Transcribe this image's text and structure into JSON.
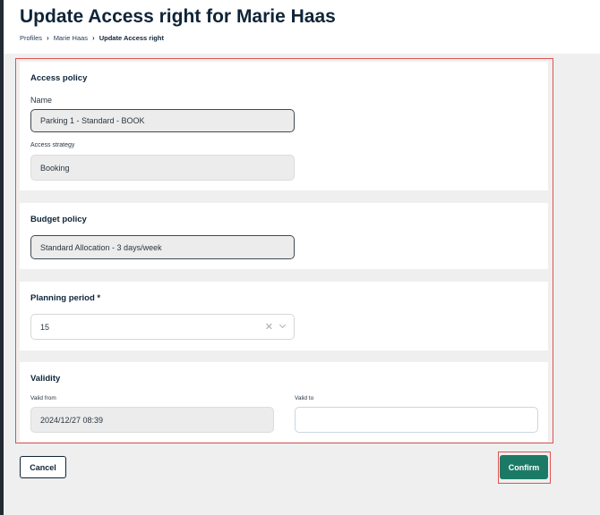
{
  "header": {
    "title": "Update Access right for Marie Haas",
    "breadcrumb": {
      "items": [
        "Profiles",
        "Marie Haas"
      ],
      "current": "Update Access right"
    }
  },
  "access_policy": {
    "title": "Access policy",
    "name_label": "Name",
    "name_value": "Parking 1 - Standard - BOOK",
    "strategy_label": "Access strategy",
    "strategy_value": "Booking"
  },
  "budget_policy": {
    "title": "Budget policy",
    "value": "Standard Allocation - 3 days/week"
  },
  "planning_period": {
    "title": "Planning period *",
    "value": "15"
  },
  "validity": {
    "title": "Validity",
    "from_label": "Valid from",
    "from_value": "2024/12/27 08:39",
    "to_label": "Valid to",
    "to_value": ""
  },
  "actions": {
    "cancel_label": "Cancel",
    "confirm_label": "Confirm"
  },
  "colors": {
    "primary": "#1b7a66",
    "navy": "#0f2438",
    "highlight": "#e05252"
  },
  "icons": {
    "breadcrumb_separator": "chevron-right-icon",
    "clear": "clear-icon",
    "dropdown": "chevron-down-icon"
  }
}
